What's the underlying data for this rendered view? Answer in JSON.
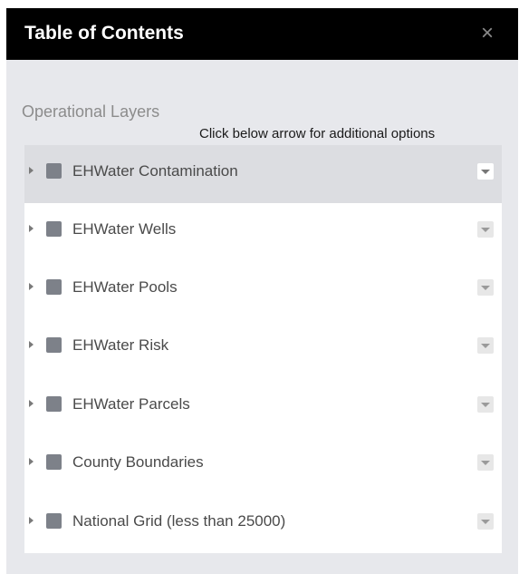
{
  "panel": {
    "title": "Table of Contents",
    "close_glyph": "×",
    "section_label": "Operational Layers",
    "hint": "Click below arrow for additional options"
  },
  "layers": [
    {
      "label": "EHWater Contamination",
      "selected": true
    },
    {
      "label": "EHWater Wells",
      "selected": false
    },
    {
      "label": "EHWater Pools",
      "selected": false
    },
    {
      "label": "EHWater Risk",
      "selected": false
    },
    {
      "label": "EHWater Parcels",
      "selected": false
    },
    {
      "label": "County Boundaries",
      "selected": false
    },
    {
      "label": "National Grid (less than 25000)",
      "selected": false
    }
  ],
  "icons": {
    "expand": "caret-right-icon",
    "layer_checkbox": "checkbox-icon",
    "options": "chevron-down-icon",
    "close": "close-icon"
  },
  "colors": {
    "titlebar_bg": "#000000",
    "panel_bg": "#e7e8ec",
    "selected_row_bg": "#dcdde1",
    "checkbox_fill": "#7d8189"
  }
}
